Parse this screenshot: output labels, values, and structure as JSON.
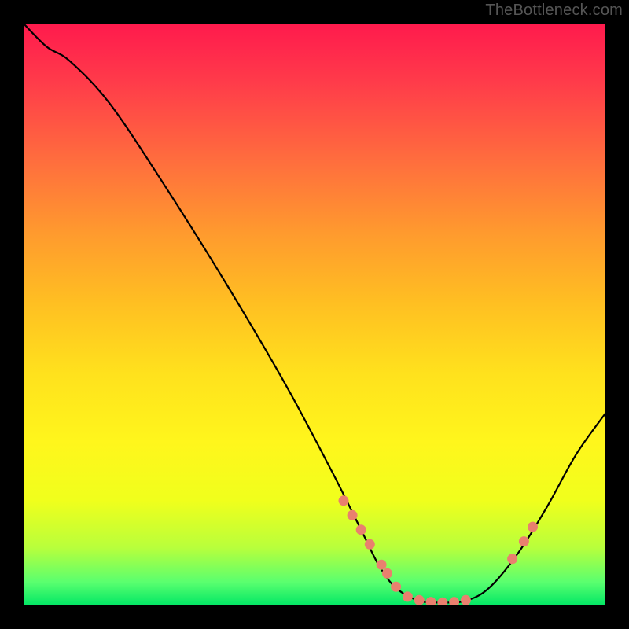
{
  "attribution": "TheBottleneck.com",
  "chart_data": {
    "type": "line",
    "title": "",
    "xlabel": "",
    "ylabel": "",
    "xlim": [
      0,
      100
    ],
    "ylim": [
      0,
      100
    ],
    "curve": [
      {
        "x": 0,
        "y": 100
      },
      {
        "x": 4,
        "y": 96
      },
      {
        "x": 8,
        "y": 93.5
      },
      {
        "x": 15,
        "y": 86
      },
      {
        "x": 25,
        "y": 71
      },
      {
        "x": 35,
        "y": 55
      },
      {
        "x": 45,
        "y": 38
      },
      {
        "x": 53,
        "y": 23
      },
      {
        "x": 58,
        "y": 13
      },
      {
        "x": 61,
        "y": 7
      },
      {
        "x": 64,
        "y": 3
      },
      {
        "x": 68,
        "y": 0.8
      },
      {
        "x": 72,
        "y": 0.5
      },
      {
        "x": 76,
        "y": 0.8
      },
      {
        "x": 80,
        "y": 3
      },
      {
        "x": 85,
        "y": 9
      },
      {
        "x": 90,
        "y": 17
      },
      {
        "x": 95,
        "y": 26
      },
      {
        "x": 100,
        "y": 33
      }
    ],
    "marker_points": [
      {
        "x": 55,
        "y": 18
      },
      {
        "x": 56.5,
        "y": 15.5
      },
      {
        "x": 58,
        "y": 13
      },
      {
        "x": 59.5,
        "y": 10.5
      },
      {
        "x": 61.5,
        "y": 7
      },
      {
        "x": 62.5,
        "y": 5.5
      },
      {
        "x": 64,
        "y": 3.2
      },
      {
        "x": 66,
        "y": 1.5
      },
      {
        "x": 68,
        "y": 0.9
      },
      {
        "x": 70,
        "y": 0.6
      },
      {
        "x": 72,
        "y": 0.5
      },
      {
        "x": 74,
        "y": 0.6
      },
      {
        "x": 76,
        "y": 0.9
      },
      {
        "x": 84,
        "y": 8
      },
      {
        "x": 86,
        "y": 11
      },
      {
        "x": 87.5,
        "y": 13.5
      }
    ]
  }
}
